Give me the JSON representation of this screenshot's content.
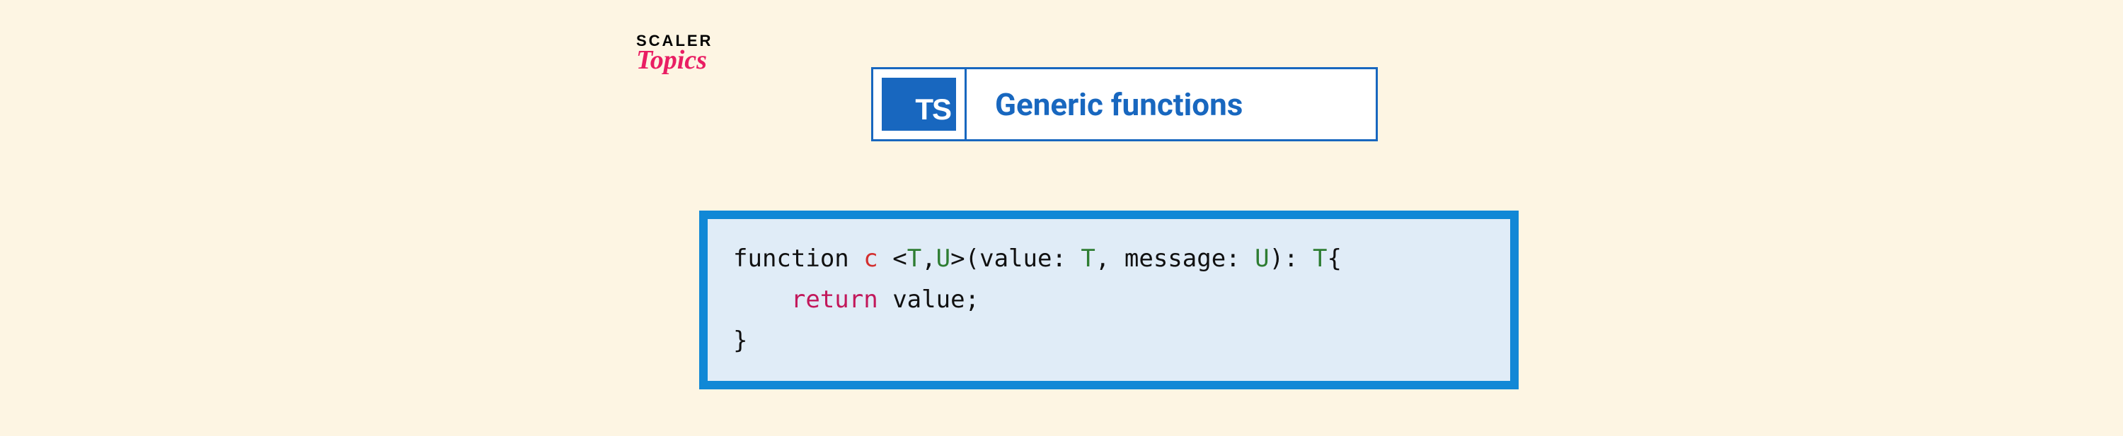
{
  "logo": {
    "line1": "SCALER",
    "line2": "Topics"
  },
  "header": {
    "badge": "TS",
    "title": "Generic functions"
  },
  "code": {
    "line1": {
      "kw_function": "function",
      "func_name": "c",
      "angle_open": "<",
      "type_t": "T",
      "comma1": ",",
      "type_u": "U",
      "angle_close": ">",
      "paren_open": "(value:",
      "type_t2": "T",
      "comma2": ",",
      "message": "message:",
      "type_u2": "U",
      "paren_close": "):",
      "ret_type": "T",
      "brace": "{"
    },
    "line2": {
      "indent": "    ",
      "return_kw": "return",
      "value": "value;"
    },
    "line3": {
      "brace": "}"
    }
  }
}
